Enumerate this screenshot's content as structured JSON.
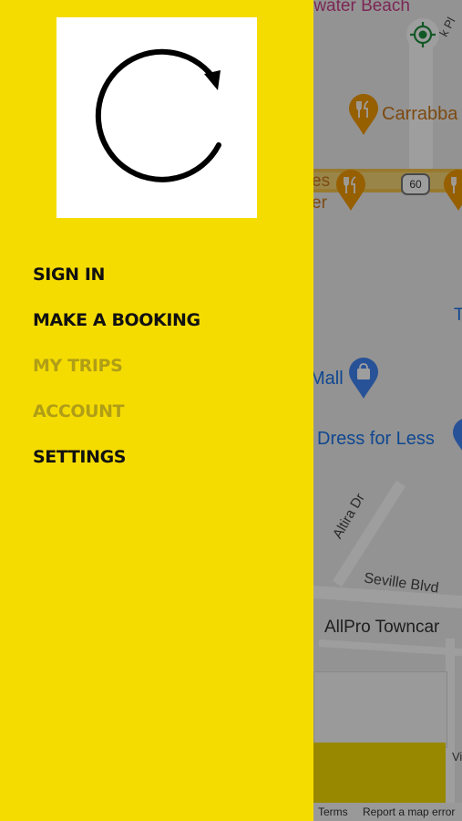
{
  "map": {
    "labels": {
      "water": "rwater Beach",
      "carrabba": "Carrabba",
      "es": "es",
      "er": "er",
      "t": "T",
      "mall": "Mall",
      "dress": "Dress for Less",
      "altira": "Altira Dr",
      "seville": "Seville Blvd",
      "allpro": "AllPro Towncar",
      "viv": "Viv",
      "k_pl": "k Pl"
    },
    "route_shield": "60",
    "footer": {
      "terms": "Terms",
      "report": "Report a map error"
    },
    "icons": {
      "restaurant_pin": "restaurant-pin-icon",
      "shopping_pin": "shopping-pin-icon",
      "locate": "my-location-icon"
    },
    "colors": {
      "restaurant_pin": "#f29900",
      "shopping_pin": "#4285f4",
      "poi_text_orange": "#c9781a",
      "poi_text_blue": "#1a73e8",
      "highway": "#f6c54c"
    }
  },
  "drawer": {
    "logo_icon": "circular-arrow-logo-icon",
    "menu": [
      {
        "label": "SIGN IN",
        "enabled": true
      },
      {
        "label": "MAKE A BOOKING",
        "enabled": true
      },
      {
        "label": "MY TRIPS",
        "enabled": false
      },
      {
        "label": "ACCOUNT",
        "enabled": false
      },
      {
        "label": "SETTINGS",
        "enabled": true
      }
    ],
    "colors": {
      "background": "#f5dc00",
      "text": "#111111",
      "text_disabled": "#b09e17"
    }
  }
}
